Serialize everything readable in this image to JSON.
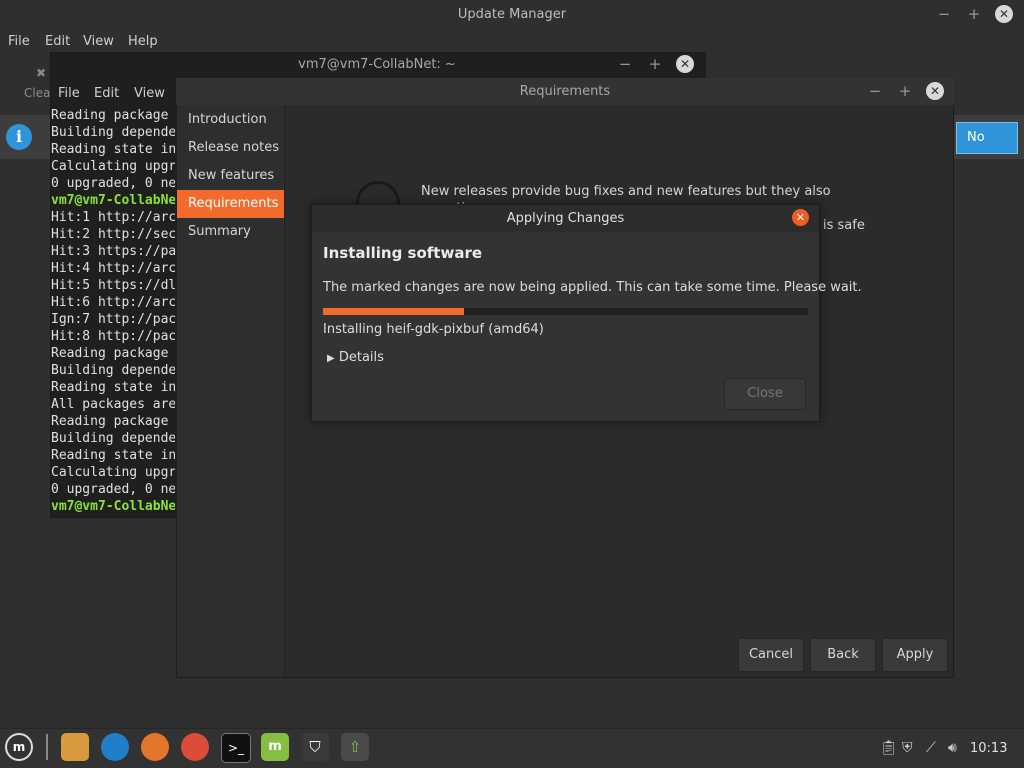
{
  "update_manager": {
    "title": "Update Manager",
    "menu": [
      "File",
      "Edit",
      "View",
      "Help"
    ],
    "toolbar_clear_label": "Clea",
    "infobar_no_label": "No"
  },
  "terminal": {
    "title": "vm7@vm7-CollabNet: ~",
    "menu": [
      "File",
      "Edit",
      "View"
    ],
    "lines": [
      {
        "text": "Reading package",
        "green": false
      },
      {
        "text": "Building depende",
        "green": false
      },
      {
        "text": "Reading state in",
        "green": false
      },
      {
        "text": "Calculating upgr",
        "green": false
      },
      {
        "text": "0 upgraded, 0 ne",
        "green": false
      },
      {
        "text": "vm7@vm7-CollabNe",
        "green": true
      },
      {
        "text": "Hit:1 http://arc",
        "green": false
      },
      {
        "text": "Hit:2 http://sec",
        "green": false
      },
      {
        "text": "Hit:3 https://pa",
        "green": false
      },
      {
        "text": "Hit:4 http://arc",
        "green": false
      },
      {
        "text": "Hit:5 https://dl",
        "green": false
      },
      {
        "text": "Hit:6 http://arc",
        "green": false
      },
      {
        "text": "Ign:7 http://pac",
        "green": false
      },
      {
        "text": "Hit:8 http://pac",
        "green": false
      },
      {
        "text": "Reading package",
        "green": false
      },
      {
        "text": "Building depende",
        "green": false
      },
      {
        "text": "Reading state in",
        "green": false
      },
      {
        "text": "All packages are",
        "green": false
      },
      {
        "text": "Reading package",
        "green": false
      },
      {
        "text": "Building depende",
        "green": false
      },
      {
        "text": "Reading state in",
        "green": false
      },
      {
        "text": "Calculating upgr",
        "green": false
      },
      {
        "text": "0 upgraded, 0 ne",
        "green": false
      },
      {
        "text": "vm7@vm7-CollabNe",
        "green": true
      }
    ]
  },
  "requirements": {
    "title": "Requirements",
    "sidebar": [
      "Introduction",
      "Release notes",
      "New features",
      "Requirements",
      "Summary"
    ],
    "active_index": 3,
    "text_line1": "New releases provide bug fixes and new features but they also sometimes",
    "text_line2_visible": "is safe",
    "buttons": {
      "cancel": "Cancel",
      "back": "Back",
      "apply": "Apply"
    }
  },
  "apply_dialog": {
    "title": "Applying Changes",
    "heading": "Installing software",
    "description": "The marked changes are now being applied. This can take some time. Please wait.",
    "progress": 0.29,
    "status": "Installing heif-gdk-pixbuf (amd64)",
    "details_label": "Details",
    "close_label": "Close",
    "accent": "#f36a2d"
  },
  "taskbar": {
    "clock": "10:13",
    "apps": [
      "mint-menu-icon",
      "files-icon",
      "edge-dev-icon",
      "firefox-icon",
      "chrome-icon",
      "terminal-icon",
      "mintupdate-icon",
      "shield-icon",
      "update-manager-icon"
    ]
  }
}
